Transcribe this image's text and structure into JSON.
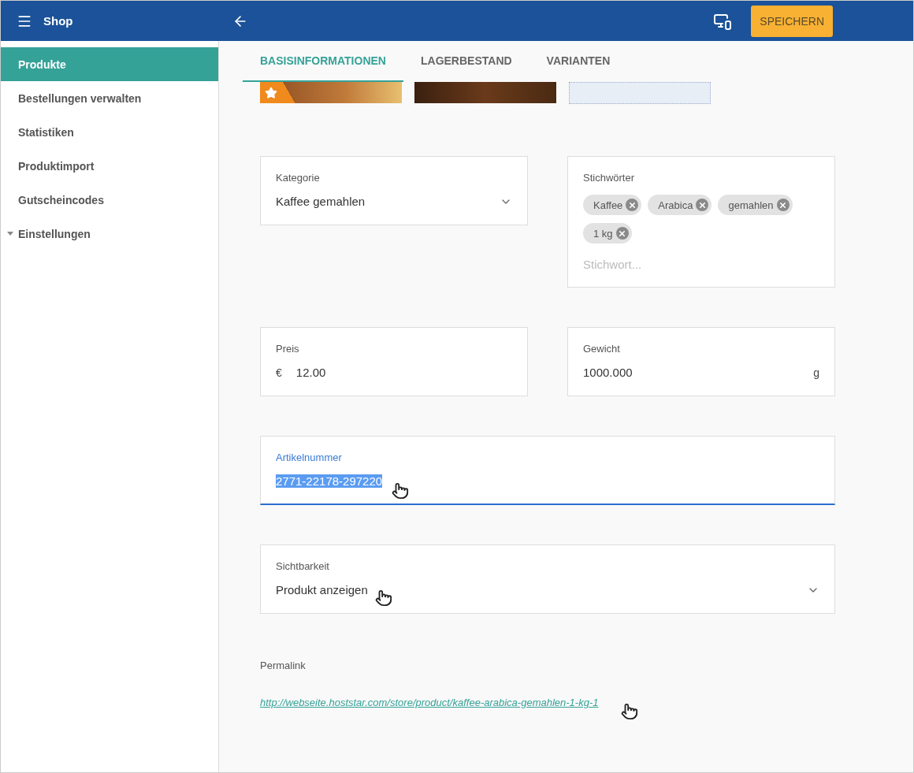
{
  "header": {
    "app_title": "Shop",
    "save_button": "SPEICHERN"
  },
  "sidebar": {
    "items": [
      {
        "label": "Produkte",
        "selected": true,
        "kind": "link"
      },
      {
        "label": "Bestellungen verwalten",
        "selected": false,
        "kind": "link"
      },
      {
        "label": "Statistiken",
        "selected": false,
        "kind": "link"
      },
      {
        "label": "Produktimport",
        "selected": false,
        "kind": "link"
      },
      {
        "label": "Gutscheincodes",
        "selected": false,
        "kind": "link"
      },
      {
        "label": "Einstellungen",
        "selected": false,
        "kind": "group"
      }
    ]
  },
  "tabs": [
    {
      "label": "BASISINFORMATIONEN",
      "selected": true
    },
    {
      "label": "LAGERBESTAND",
      "selected": false
    },
    {
      "label": "VARIANTEN",
      "selected": false
    }
  ],
  "images": [
    {
      "kind": "photo",
      "featured": true
    },
    {
      "kind": "photo",
      "featured": false
    },
    {
      "kind": "upload"
    }
  ],
  "fields": [
    {
      "kind": "select",
      "label": "Kategorie",
      "value": "Kaffee gemahlen",
      "wide": false
    },
    {
      "kind": "tags",
      "label": "Stichwörter",
      "tags": [
        "Kaffee",
        "Arabica",
        "gemahlen",
        "1 kg"
      ],
      "placeholder": "Stichwort...",
      "wide": false
    },
    {
      "kind": "money",
      "label": "Preis",
      "prefix": "€",
      "value": "12.00",
      "wide": false
    },
    {
      "kind": "unit",
      "label": "Gewicht",
      "value": "1000.000",
      "suffix": "g",
      "wide": false
    },
    {
      "kind": "text",
      "label": "Artikelnummer",
      "value": "2771-22178-297220",
      "focused": true,
      "wide": true
    },
    {
      "kind": "select",
      "label": "Sichtbarkeit",
      "value": "Produkt anzeigen",
      "wide": true
    }
  ],
  "permalink": {
    "label": "Permalink",
    "url": "http://webseite.hoststar.com/store/product/kaffee-arabica-gemahlen-1-kg-1"
  }
}
